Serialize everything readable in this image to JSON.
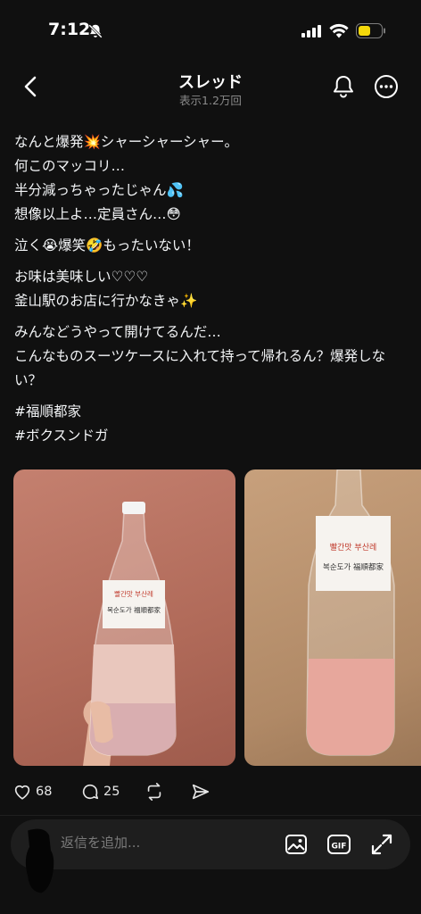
{
  "status": {
    "time": "7:12"
  },
  "header": {
    "title": "スレッド",
    "views": "表示1.2万回"
  },
  "post": {
    "paragraphs": [
      [
        "なんと爆発💥シャーシャーシャー。",
        "何このマッコリ…",
        "半分減っちゃったじゃん💦",
        "想像以上よ…定員さん…😳"
      ],
      [
        "泣く😭爆笑🤣もったいない！"
      ],
      [
        "お味は美味しい♡♡♡",
        "釜山駅のお店に行かなきゃ✨"
      ],
      [
        "みんなどうやって開けてるんだ…",
        "こんなものスーツケースに入れて持って帰れるん？爆発しない？"
      ]
    ],
    "hashtags": [
      "#福順都家",
      "#ボクスンドガ"
    ],
    "label_line1": "빨간맛 부산레",
    "label_line2": "복순도가 福順都家"
  },
  "actions": {
    "likes": "68",
    "replies": "25"
  },
  "reply": {
    "placeholder": "返信を追加...",
    "gif_label": "GIF"
  },
  "colors": {
    "background": "#101010",
    "text": "#f3f5f7",
    "muted": "#8a8a8a",
    "battery": "#f5d90a"
  }
}
